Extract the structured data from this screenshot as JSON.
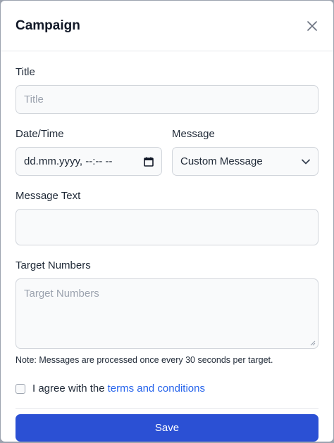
{
  "modal": {
    "title": "Campaign"
  },
  "form": {
    "title_label": "Title",
    "title_placeholder": "Title",
    "datetime_label": "Date/Time",
    "datetime_value": "dd.mm.yyyy, --:-- --",
    "message_label": "Message",
    "message_selected": "Custom Message",
    "message_text_label": "Message Text",
    "message_text_value": "",
    "target_numbers_label": "Target Numbers",
    "target_numbers_placeholder": "Target Numbers",
    "note": "Note: Messages are processed once every 30 seconds per target.",
    "agree_prefix": "I agree with the",
    "agree_link": "terms and conditions",
    "agree_checked": false,
    "save_label": "Save"
  },
  "colors": {
    "accent": "#2b50d4",
    "link": "#2563eb"
  },
  "icons": {
    "close": "close-icon",
    "calendar": "calendar-icon",
    "dropdown": "chevron-down-icon"
  }
}
